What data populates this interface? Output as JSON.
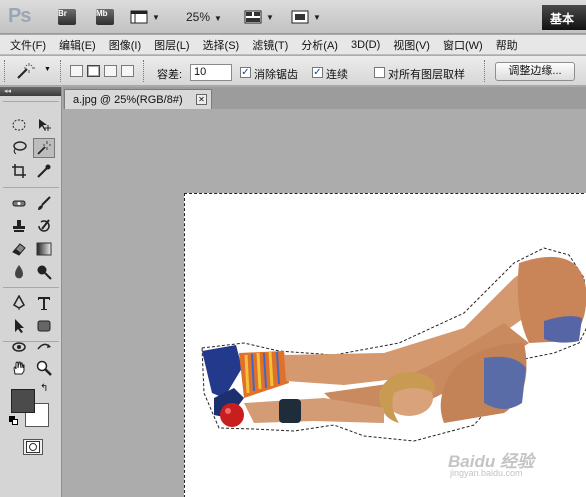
{
  "app": {
    "logo": "Ps",
    "zoom": "25%",
    "workspace": "基本"
  },
  "appbar_buttons": [
    {
      "icon": "bridge-icon",
      "label": "Br"
    },
    {
      "icon": "minibridge-icon",
      "label": "Mb"
    },
    {
      "icon": "view-extras-icon"
    },
    {
      "icon": "arrange-documents-icon"
    },
    {
      "icon": "screen-mode-icon"
    }
  ],
  "menu": [
    "文件(F)",
    "编辑(E)",
    "图像(I)",
    "图层(L)",
    "选择(S)",
    "滤镜(T)",
    "分析(A)",
    "3D(D)",
    "视图(V)",
    "窗口(W)",
    "帮助"
  ],
  "options": {
    "tolerance_label": "容差:",
    "tolerance_value": "10",
    "antialias_label": "消除锯齿",
    "antialias_checked": true,
    "contiguous_label": "连续",
    "contiguous_checked": true,
    "sample_all_label": "对所有图层取样",
    "sample_all_checked": false,
    "refine_edge": "调整边缘..."
  },
  "tools_panel": {
    "collapse": "◂◂"
  },
  "document": {
    "tab_title": "a.jpg @ 25%(RGB/8#)",
    "close": "✕"
  },
  "colors": {
    "foreground": "#4b4b4b",
    "background": "#ffffff"
  },
  "watermark": {
    "text": "Baidu 经验",
    "sub": "jingyan.baidu.com"
  }
}
